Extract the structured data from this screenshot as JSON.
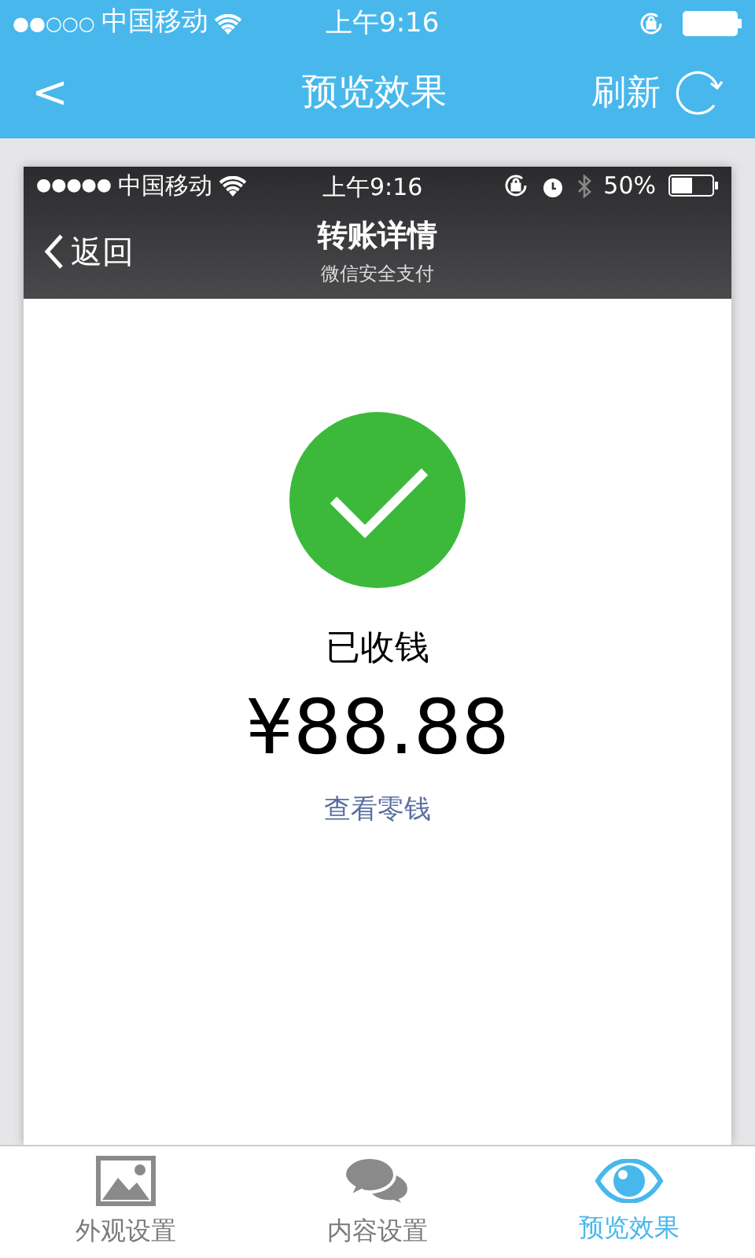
{
  "status_bar": {
    "signal": "●●○○○",
    "carrier": "中国移动",
    "time": "上午9:16"
  },
  "nav": {
    "back": "<",
    "title": "预览效果",
    "action": "刷新"
  },
  "preview": {
    "status_bar": {
      "signal": "●●●●●",
      "carrier": "中国移动",
      "time": "上午9:16",
      "battery": "50%"
    },
    "nav": {
      "back": "返回",
      "title": "转账详情",
      "subtitle": "微信安全支付"
    },
    "status": "已收钱",
    "amount": "¥88.88",
    "link": "查看零钱"
  },
  "tabs": [
    {
      "label": "外观设置",
      "kind": "image",
      "selected": false
    },
    {
      "label": "内容设置",
      "kind": "chat",
      "selected": false
    },
    {
      "label": "预览效果",
      "kind": "eye",
      "selected": true
    }
  ]
}
